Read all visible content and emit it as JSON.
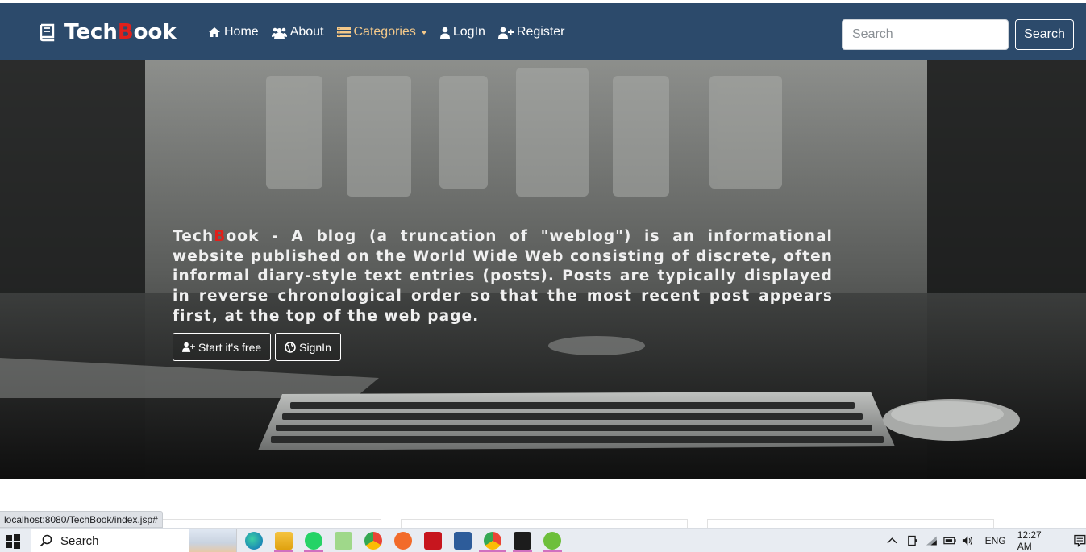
{
  "navbar": {
    "brand_prefix": "Tech",
    "brand_highlight": "B",
    "brand_suffix": "ook",
    "items": [
      {
        "label": "Home",
        "icon": "home-icon"
      },
      {
        "label": "About",
        "icon": "users-icon"
      },
      {
        "label": "Categories",
        "icon": "categories-icon"
      },
      {
        "label": "LogIn",
        "icon": "user-icon"
      },
      {
        "label": "Register",
        "icon": "user-plus-icon"
      }
    ],
    "search_placeholder": "Search",
    "search_button": "Search",
    "colors": {
      "background": "#2c4a6b",
      "accent": "#f4c98a",
      "brand_red": "#e0201b"
    }
  },
  "hero": {
    "text_prefix": "Tech",
    "text_highlight": "B",
    "text_body": "ook - A blog (a truncation of \"weblog\") is an informational website published on the World Wide Web consisting of discrete, often informal diary-style text entries (posts). Posts are typically displayed in reverse chronological order so that the most recent post appears first, at the top of the web page.",
    "btn_start": "Start it's free",
    "btn_signin": "SignIn"
  },
  "status_bar": {
    "url": "localhost:8080/TechBook/index.jsp#"
  },
  "taskbar": {
    "search_label": "Search",
    "language": "ENG",
    "time": "12:27 AM",
    "apps": [
      "edge-icon",
      "file-explorer-icon",
      "whatsapp-icon",
      "notepad-icon",
      "chrome-icon",
      "brave-icon",
      "acrobat-icon",
      "window-icon",
      "chrome-active-icon",
      "terminal-icon",
      "app-icon"
    ]
  }
}
